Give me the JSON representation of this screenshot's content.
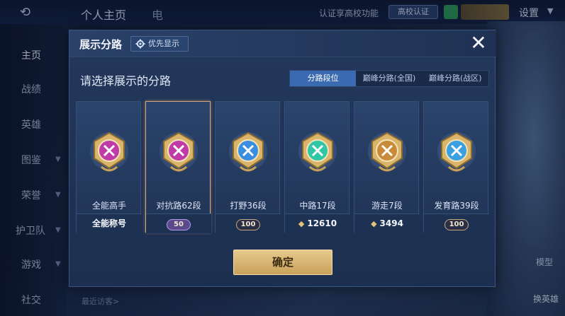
{
  "background": {
    "back_icon": "back-arrow-icon",
    "tabs": [
      "个人主页",
      "电"
    ],
    "auth_hint": "认证享高校功能",
    "auth_button": "高校认证",
    "settings": "设置",
    "nav": [
      "主页",
      "战绩",
      "英雄",
      "图鉴",
      "荣誉",
      "护卫队",
      "游戏",
      "社交"
    ],
    "recent_visitors": "最近访客>",
    "model_label": "模型",
    "switch_hero": "换英雄"
  },
  "modal": {
    "title": "展示分路",
    "priority_button": "优先显示",
    "prompt": "请选择展示的分路",
    "tabs": [
      {
        "label": "分路段位",
        "active": true
      },
      {
        "label": "巅峰分路(全国)",
        "active": false
      },
      {
        "label": "巅峰分路(战区)",
        "active": false
      }
    ],
    "cards": [
      {
        "name": "全能高手",
        "footer": "全能称号",
        "footer_type": "text",
        "color": "#c03aa8",
        "selected": false
      },
      {
        "name": "对抗路62段",
        "footer": "50",
        "footer_type": "badge-purple",
        "color": "#c03aa8",
        "selected": true
      },
      {
        "name": "打野36段",
        "footer": "100",
        "footer_type": "badge",
        "color": "#3a8ee0",
        "selected": false
      },
      {
        "name": "中路17段",
        "footer": "12610",
        "footer_type": "score",
        "color": "#2fc7a6",
        "selected": false
      },
      {
        "name": "游走7段",
        "footer": "3494",
        "footer_type": "score",
        "color": "#c98a3a",
        "selected": false
      },
      {
        "name": "发育路39段",
        "footer": "100",
        "footer_type": "badge",
        "color": "#3aa0e0",
        "selected": false
      }
    ],
    "confirm": "确定",
    "close_icon": "close-icon"
  },
  "colors": {
    "accent": "#3a6bb0",
    "confirm_gold": "#d4b06d",
    "selected_border": "#d8a57a"
  }
}
